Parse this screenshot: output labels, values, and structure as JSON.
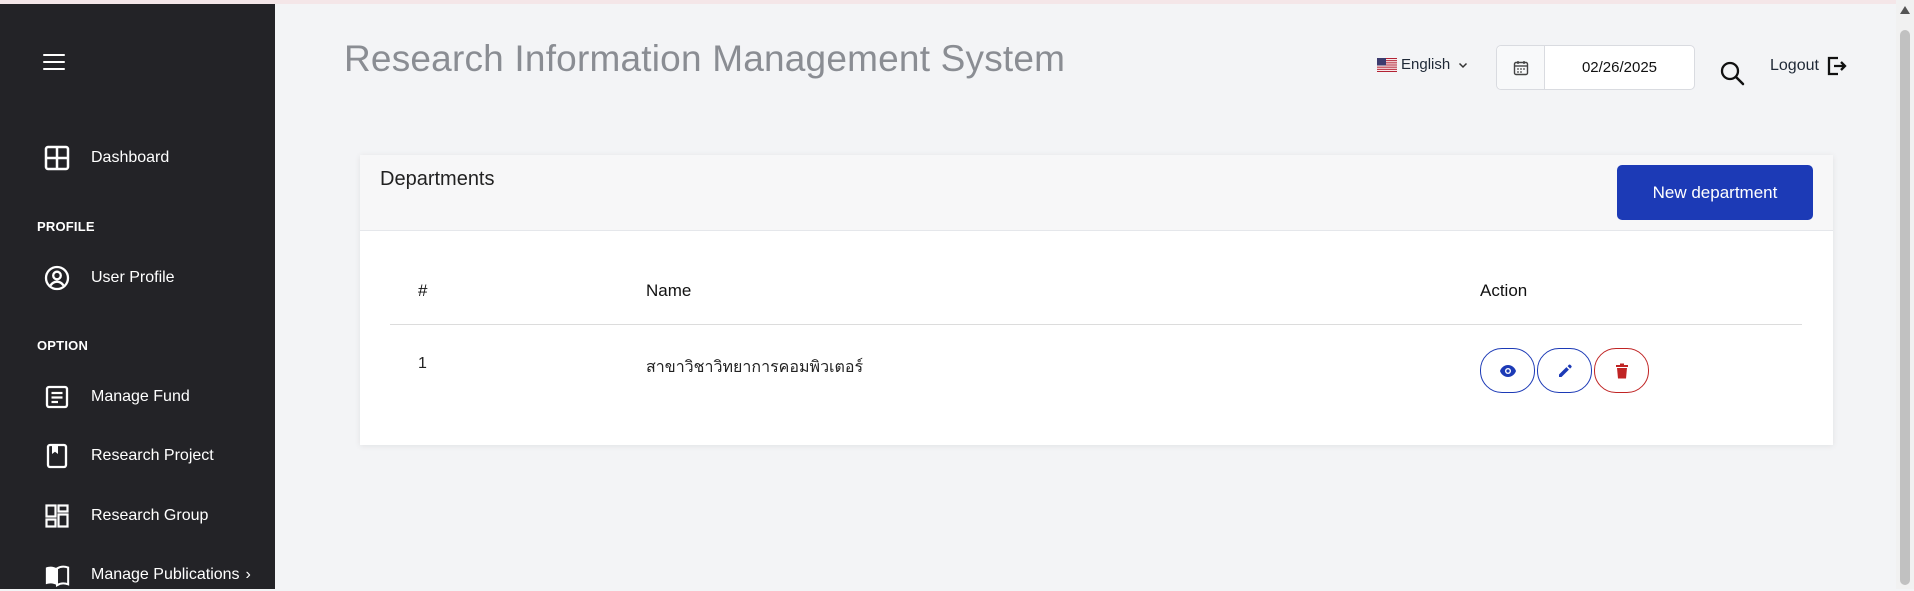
{
  "app": {
    "title": "Research Information Management System"
  },
  "header": {
    "language": "English",
    "date": "02/26/2025",
    "logout_label": "Logout"
  },
  "sidebar": {
    "items": [
      {
        "label": "Dashboard",
        "icon": "dashboard-icon"
      },
      {
        "label": "User Profile",
        "icon": "user-circle-icon"
      },
      {
        "label": "Manage Fund",
        "icon": "document-icon"
      },
      {
        "label": "Research Project",
        "icon": "bookmark-icon"
      },
      {
        "label": "Research Group",
        "icon": "grid-icon"
      },
      {
        "label": "Manage Publications",
        "icon": "book-open-icon",
        "chevron": "›"
      }
    ],
    "sections": {
      "profile": "PROFILE",
      "option": "OPTION"
    }
  },
  "card": {
    "title": "Departments",
    "new_button": "New department",
    "columns": {
      "index": "#",
      "name": "Name",
      "action": "Action"
    },
    "rows": [
      {
        "index": "1",
        "name": "สาขาวิชาวิทยาการคอมพิวเตอร์"
      }
    ]
  },
  "colors": {
    "sidebar_bg": "#232327",
    "primary": "#1c3ab6",
    "danger": "#c02424",
    "title_gray": "#8a8d93"
  }
}
